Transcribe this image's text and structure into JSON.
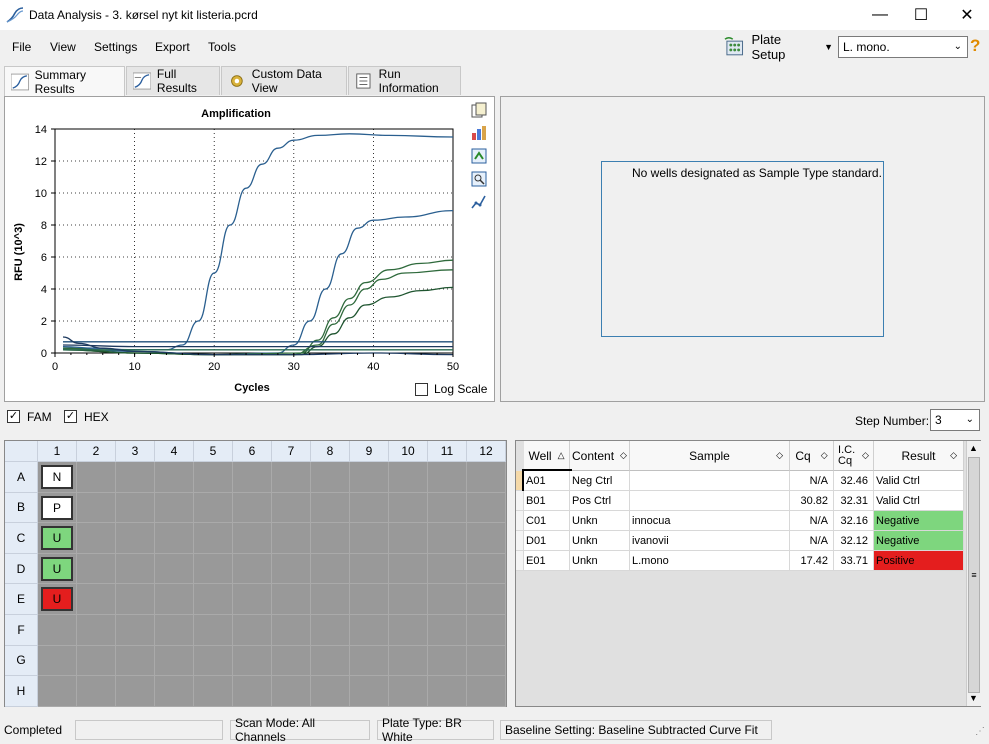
{
  "window": {
    "title": "Data Analysis - 3. kørsel nyt kit listeria.pcrd",
    "minimize": "—",
    "maximize": "☐",
    "close": "✕"
  },
  "menu": {
    "file": "File",
    "view": "View",
    "settings": "Settings",
    "export": "Export",
    "tools": "Tools",
    "plate_setup": "Plate Setup",
    "target_select": "L. mono.",
    "help": "?"
  },
  "tabs": [
    {
      "label": "Summary Results"
    },
    {
      "label": "Full Results"
    },
    {
      "label": "Custom Data View"
    },
    {
      "label": "Run Information"
    }
  ],
  "chart_data": {
    "type": "line",
    "title": "Amplification",
    "xlabel": "Cycles",
    "ylabel": "RFU (10^3)",
    "xlim": [
      0,
      50
    ],
    "ylim": [
      0,
      14
    ],
    "xticks": [
      0,
      10,
      20,
      30,
      40,
      50
    ],
    "yticks": [
      0,
      2,
      4,
      6,
      8,
      10,
      12,
      14
    ],
    "grid": true,
    "series": [
      {
        "color": "#2a5f8f",
        "points": [
          [
            1,
            0.4
          ],
          [
            5,
            0.3
          ],
          [
            10,
            0.2
          ],
          [
            14,
            0.2
          ],
          [
            16,
            0.5
          ],
          [
            18,
            2.0
          ],
          [
            20,
            5.0
          ],
          [
            22,
            8.0
          ],
          [
            24,
            10.3
          ],
          [
            26,
            11.8
          ],
          [
            28,
            12.8
          ],
          [
            30,
            13.3
          ],
          [
            33,
            13.6
          ],
          [
            37,
            13.7
          ],
          [
            42,
            13.6
          ],
          [
            50,
            13.5
          ]
        ]
      },
      {
        "color": "#2a5f8f",
        "points": [
          [
            1,
            0.3
          ],
          [
            10,
            0.1
          ],
          [
            20,
            -0.1
          ],
          [
            28,
            0.0
          ],
          [
            30,
            0.5
          ],
          [
            32,
            2.0
          ],
          [
            34,
            4.0
          ],
          [
            36,
            6.2
          ],
          [
            38,
            7.8
          ],
          [
            40,
            8.3
          ],
          [
            44,
            8.5
          ],
          [
            50,
            8.9
          ]
        ]
      },
      {
        "color": "#2f6a3c",
        "points": [
          [
            1,
            0.2
          ],
          [
            10,
            0.0
          ],
          [
            20,
            -0.1
          ],
          [
            30,
            -0.1
          ],
          [
            33,
            0.5
          ],
          [
            35,
            1.8
          ],
          [
            37,
            3.0
          ],
          [
            39,
            4.0
          ],
          [
            41,
            4.6
          ],
          [
            44,
            5.0
          ],
          [
            50,
            5.2
          ]
        ]
      },
      {
        "color": "#2f6a3c",
        "points": [
          [
            1,
            0.3
          ],
          [
            10,
            0.0
          ],
          [
            20,
            -0.1
          ],
          [
            31,
            0.0
          ],
          [
            33,
            0.8
          ],
          [
            35,
            2.2
          ],
          [
            37,
            3.4
          ],
          [
            39,
            4.4
          ],
          [
            42,
            5.2
          ],
          [
            46,
            5.6
          ],
          [
            50,
            5.8
          ]
        ]
      },
      {
        "color": "#1f5530",
        "points": [
          [
            1,
            0.2
          ],
          [
            10,
            0.0
          ],
          [
            20,
            -0.1
          ],
          [
            31,
            -0.1
          ],
          [
            33,
            0.4
          ],
          [
            35,
            1.2
          ],
          [
            37,
            2.2
          ],
          [
            39,
            3.0
          ],
          [
            42,
            3.5
          ],
          [
            46,
            3.9
          ],
          [
            50,
            4.1
          ]
        ]
      },
      {
        "color": "#1f4f7a",
        "points": [
          [
            1,
            0.7
          ],
          [
            10,
            0.7
          ],
          [
            20,
            0.7
          ],
          [
            30,
            0.7
          ],
          [
            40,
            0.7
          ],
          [
            50,
            0.7
          ]
        ]
      },
      {
        "color": "#1e3a5f",
        "points": [
          [
            1,
            0.5
          ],
          [
            10,
            0.4
          ],
          [
            20,
            0.4
          ],
          [
            30,
            0.4
          ],
          [
            40,
            0.4
          ],
          [
            50,
            0.4
          ]
        ]
      },
      {
        "color": "#2a6b50",
        "points": [
          [
            1,
            0.2
          ],
          [
            10,
            0.2
          ],
          [
            20,
            0.2
          ],
          [
            30,
            0.2
          ],
          [
            40,
            0.2
          ],
          [
            50,
            0.2
          ]
        ]
      },
      {
        "color": "#1e3a5f",
        "points": [
          [
            1,
            1.0
          ],
          [
            3,
            0.6
          ],
          [
            6,
            0.3
          ],
          [
            10,
            0.1
          ],
          [
            20,
            -0.1
          ],
          [
            30,
            -0.1
          ],
          [
            40,
            0.0
          ],
          [
            50,
            -0.1
          ]
        ]
      }
    ]
  },
  "chart_controls": {
    "log_scale": "Log Scale"
  },
  "std_panel": {
    "message": "No wells designated as Sample Type standard."
  },
  "filters": {
    "fam": "FAM",
    "hex": "HEX",
    "step_label": "Step Number:",
    "step_value": "3"
  },
  "plate": {
    "cols": [
      "1",
      "2",
      "3",
      "4",
      "5",
      "6",
      "7",
      "8",
      "9",
      "10",
      "11",
      "12"
    ],
    "rows": [
      "A",
      "B",
      "C",
      "D",
      "E",
      "F",
      "G",
      "H"
    ],
    "wells": [
      {
        "label": "N",
        "color": "#ffffff"
      },
      {
        "label": "P",
        "color": "#ffffff"
      },
      {
        "label": "U",
        "color": "#7ed67e"
      },
      {
        "label": "U",
        "color": "#7ed67e"
      },
      {
        "label": "U",
        "color": "#e41e1e"
      }
    ]
  },
  "results": {
    "headers": {
      "well": "Well",
      "content": "Content",
      "sample": "Sample",
      "cq": "Cq",
      "ic_cq": "I.C. Cq",
      "result": "Result"
    },
    "rows": [
      {
        "well": "A01",
        "content": "Neg Ctrl",
        "sample": "",
        "cq": "N/A",
        "ic": "32.46",
        "result": "Valid Ctrl",
        "color": "#ffffff"
      },
      {
        "well": "B01",
        "content": "Pos Ctrl",
        "sample": "",
        "cq": "30.82",
        "ic": "32.31",
        "result": "Valid Ctrl",
        "color": "#ffffff"
      },
      {
        "well": "C01",
        "content": "Unkn",
        "sample": "innocua",
        "cq": "N/A",
        "ic": "32.16",
        "result": "Negative",
        "color": "#7ed67e"
      },
      {
        "well": "D01",
        "content": "Unkn",
        "sample": "ivanovii",
        "cq": "N/A",
        "ic": "32.12",
        "result": "Negative",
        "color": "#7ed67e"
      },
      {
        "well": "E01",
        "content": "Unkn",
        "sample": "L.mono",
        "cq": "17.42",
        "ic": "33.71",
        "result": "Positive",
        "color": "#e41e1e"
      }
    ]
  },
  "status": {
    "state": "Completed",
    "scan_mode": "Scan Mode: All Channels",
    "plate_type": "Plate Type: BR White",
    "baseline": "Baseline Setting: Baseline Subtracted Curve Fit"
  }
}
